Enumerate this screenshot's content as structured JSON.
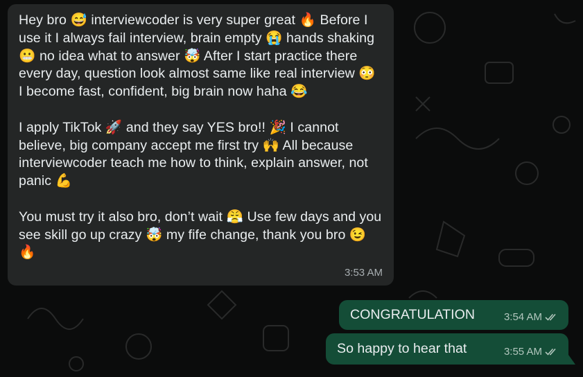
{
  "chat": {
    "incoming_message": {
      "paragraphs": [
        "Hey bro 😅 interviewcoder is very super great 🔥 Before I use it I always fail interview, brain empty 😭 hands shaking 😬 no idea what to answer 🤯 After I start practice there every day, question look almost same like real interview 😳 I become fast, confident, big brain now haha 😂",
        "I apply TikTok 🚀 and they say YES bro!! 🎉 I cannot believe, big company accept me first try 🙌 All because interviewcoder teach me how to think, explain answer, not panic 💪",
        "You must try it also bro, don’t wait 😤 Use few days and you see skill go up crazy 🤯 my fife change, thank you bro 😉 🔥"
      ],
      "time": "3:53 AM"
    },
    "outgoing_messages": [
      {
        "text": "CONGRATULATION",
        "time": "3:54 AM",
        "status_icon": "double-check-icon"
      },
      {
        "text": "So happy to hear that",
        "time": "3:55 AM",
        "status_icon": "double-check-icon"
      }
    ]
  },
  "colors": {
    "background": "#0b0c0c",
    "incoming_bubble": "#242626",
    "outgoing_bubble": "#144d37",
    "text": "#e9edef",
    "timestamp": "#a8aeb1"
  }
}
